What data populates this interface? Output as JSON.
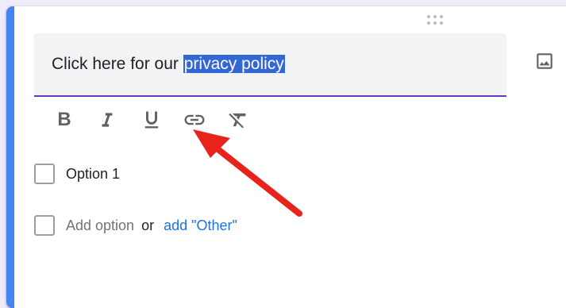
{
  "question": {
    "text_before": "Click here for our ",
    "selected_text": "privacy policy"
  },
  "toolbar": {
    "bold_label": "B",
    "buttons": [
      "bold-icon",
      "italic-icon",
      "underline-icon",
      "link-icon",
      "clear-formatting-icon"
    ]
  },
  "options": [
    {
      "label": "Option 1",
      "checked": false
    }
  ],
  "add_option": {
    "label": "Add option",
    "or_text": "or",
    "other_link": "add \"Other\""
  },
  "icons": {
    "image": "image-icon",
    "drag": "drag-handle-icon"
  },
  "colors": {
    "accent_left_border": "#4285f4",
    "field_underline": "#673ab7",
    "selection": "#3367d6",
    "link": "#1a73e8",
    "annotation_arrow": "#e8231c"
  }
}
